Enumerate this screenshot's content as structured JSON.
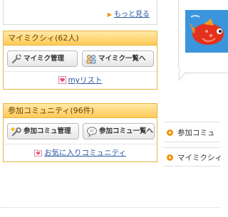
{
  "top": {
    "more_link": "もっと見る"
  },
  "mymixi": {
    "header": "マイミクシィ(62人)",
    "manage_button": "マイミク管理",
    "list_button": "マイミク一覧へ",
    "mylist_link": "myリスト"
  },
  "community": {
    "header": "参加コミュニティ(96件)",
    "manage_button": "参加コミュ管理",
    "list_button": "参加コミュ一覧へ",
    "favorites_link": "お気に入りコミュニティ"
  },
  "right": {
    "link1": "参加コミュ",
    "link2": "マイミクシィ"
  },
  "colors": {
    "accent": "#f29400",
    "header_bg": "#ffcb57",
    "link": "#2c5aa0"
  }
}
